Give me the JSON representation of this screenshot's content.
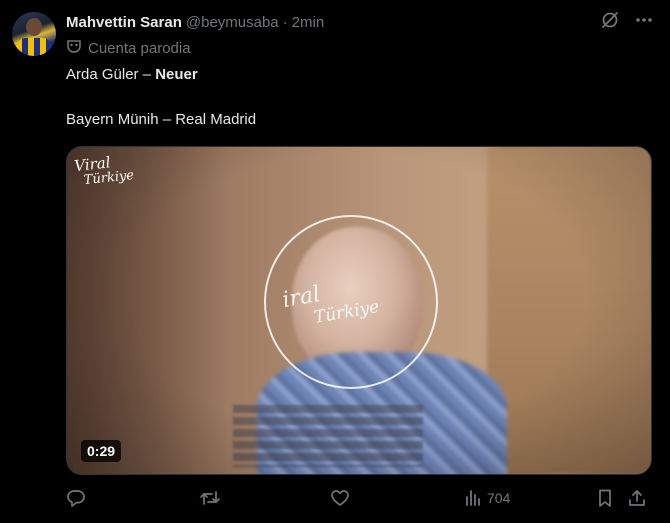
{
  "tweet": {
    "display_name": "Mahvettin Saran",
    "handle": "@beymusaba",
    "separator": "·",
    "time": "2min",
    "parody_label": "Cuenta parodia",
    "line1_normal": "Arda Güler – ",
    "line1_bold": "Neuer",
    "line2": "Bayern Münih – Real Madrid"
  },
  "media": {
    "duration": "0:29",
    "logo_line1": "Viral",
    "logo_line2": "Türkiye",
    "watermark_line1": "iral",
    "watermark_line2": "Türkiye"
  },
  "actions": {
    "views": "704"
  },
  "icons": {
    "avatar": "avatar",
    "grok": "grok-icon",
    "more": "more-icon",
    "mask": "mask-icon",
    "reply": "reply-icon",
    "retweet": "retweet-icon",
    "like": "like-icon",
    "views": "views-icon",
    "bookmark": "bookmark-icon",
    "share": "share-icon"
  },
  "colors": {
    "background": "#000000",
    "text": "#e7e9ea",
    "muted": "#71767b"
  }
}
